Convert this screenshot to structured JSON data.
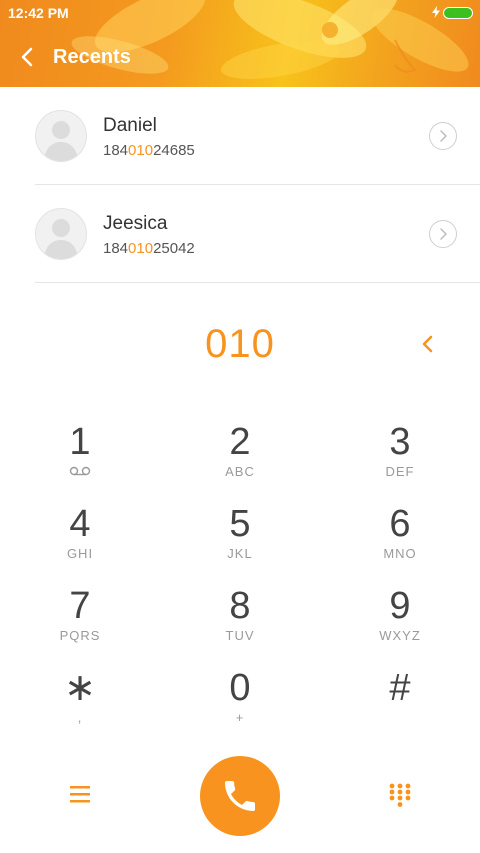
{
  "status_bar": {
    "time": "12:42 PM",
    "battery_icon": "battery-icon",
    "charge_icon": "charging-bolt-icon"
  },
  "header": {
    "title": "Recents",
    "back_icon": "back-chevron-icon"
  },
  "recents": [
    {
      "name": "Daniel",
      "number_prefix": "184",
      "number_match": "010",
      "number_suffix": "24685"
    },
    {
      "name": "Jeesica",
      "number_prefix": "184",
      "number_match": "010",
      "number_suffix": "25042"
    }
  ],
  "dialed_number": "010",
  "keypad": [
    {
      "digit": "1",
      "letters": ""
    },
    {
      "digit": "2",
      "letters": "ABC"
    },
    {
      "digit": "3",
      "letters": "DEF"
    },
    {
      "digit": "4",
      "letters": "GHI"
    },
    {
      "digit": "5",
      "letters": "JKL"
    },
    {
      "digit": "6",
      "letters": "MNO"
    },
    {
      "digit": "7",
      "letters": "PQRS"
    },
    {
      "digit": "8",
      "letters": "TUV"
    },
    {
      "digit": "9",
      "letters": "WXYZ"
    },
    {
      "digit": "∗",
      "letters": ","
    },
    {
      "digit": "0",
      "letters": "+"
    },
    {
      "digit": "#",
      "letters": ""
    }
  ],
  "bottom_bar": {
    "menu_icon": "menu-icon",
    "call_icon": "phone-icon",
    "dialpad_icon": "dialpad-icon"
  },
  "colors": {
    "accent": "#f7931e",
    "battery": "#3cbf1f"
  }
}
